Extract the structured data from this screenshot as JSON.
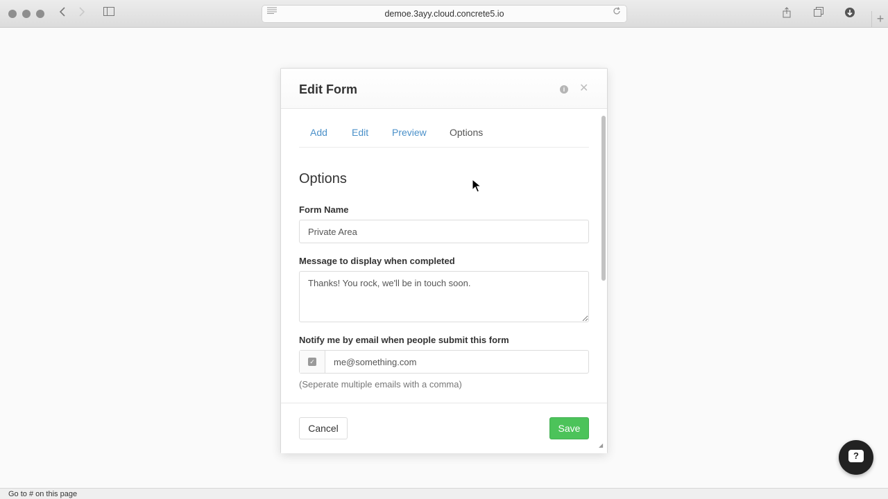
{
  "browser": {
    "url": "demoe.3ayy.cloud.concrete5.io",
    "status_text": "Go to # on this page"
  },
  "dialog": {
    "title": "Edit Form",
    "tabs": [
      {
        "label": "Add"
      },
      {
        "label": "Edit"
      },
      {
        "label": "Preview"
      },
      {
        "label": "Options",
        "active": true
      }
    ],
    "section_title": "Options",
    "form_name": {
      "label": "Form Name",
      "value": "Private Area"
    },
    "message": {
      "label": "Message to display when completed",
      "value": "Thanks! You rock, we'll be in touch soon."
    },
    "notify": {
      "label": "Notify me by email when people submit this form",
      "checked": true,
      "value": "me@something.com",
      "help": "(Seperate multiple emails with a comma)"
    },
    "buttons": {
      "cancel": "Cancel",
      "save": "Save"
    }
  },
  "colors": {
    "link": "#4a90c9",
    "save_button": "#4cc35a"
  }
}
